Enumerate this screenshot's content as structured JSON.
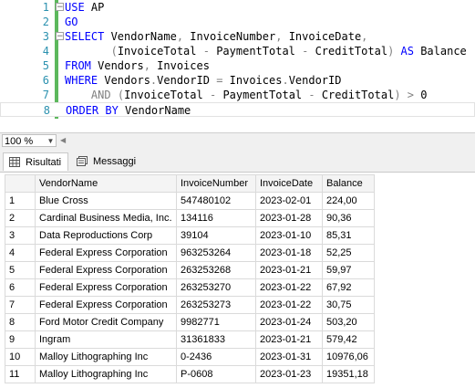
{
  "editor": {
    "lines": [
      {
        "n": "1",
        "tokens": [
          [
            "kw",
            "USE"
          ],
          [
            "tx",
            " AP"
          ]
        ]
      },
      {
        "n": "2",
        "tokens": [
          [
            "kw",
            "GO"
          ]
        ]
      },
      {
        "n": "3",
        "tokens": [
          [
            "kw",
            "SELECT"
          ],
          [
            "tx",
            " VendorName"
          ],
          [
            "op",
            ","
          ],
          [
            "tx",
            " InvoiceNumber"
          ],
          [
            "op",
            ","
          ],
          [
            "tx",
            " InvoiceDate"
          ],
          [
            "op",
            ","
          ]
        ]
      },
      {
        "n": "4",
        "tokens": [
          [
            "tx",
            "       "
          ],
          [
            "op",
            "("
          ],
          [
            "tx",
            "InvoiceTotal "
          ],
          [
            "op",
            "-"
          ],
          [
            "tx",
            " PaymentTotal "
          ],
          [
            "op",
            "-"
          ],
          [
            "tx",
            " CreditTotal"
          ],
          [
            "op",
            ")"
          ],
          [
            "kw",
            " AS"
          ],
          [
            "tx",
            " Balance"
          ]
        ]
      },
      {
        "n": "5",
        "tokens": [
          [
            "kw",
            "FROM"
          ],
          [
            "tx",
            " Vendors"
          ],
          [
            "op",
            ","
          ],
          [
            "tx",
            " Invoices"
          ]
        ]
      },
      {
        "n": "6",
        "tokens": [
          [
            "kw",
            "WHERE"
          ],
          [
            "tx",
            " Vendors"
          ],
          [
            "op",
            "."
          ],
          [
            "tx",
            "VendorID "
          ],
          [
            "op",
            "="
          ],
          [
            "tx",
            " Invoices"
          ],
          [
            "op",
            "."
          ],
          [
            "tx",
            "VendorID"
          ]
        ]
      },
      {
        "n": "7",
        "tokens": [
          [
            "tx",
            "    "
          ],
          [
            "op",
            "AND"
          ],
          [
            "tx",
            " "
          ],
          [
            "op",
            "("
          ],
          [
            "tx",
            "InvoiceTotal "
          ],
          [
            "op",
            "-"
          ],
          [
            "tx",
            " PaymentTotal "
          ],
          [
            "op",
            "-"
          ],
          [
            "tx",
            " CreditTotal"
          ],
          [
            "op",
            ")"
          ],
          [
            "tx",
            " "
          ],
          [
            "op",
            ">"
          ],
          [
            "tx",
            " 0"
          ]
        ]
      },
      {
        "n": "8",
        "tokens": [
          [
            "kw",
            "ORDER BY"
          ],
          [
            "tx",
            " VendorName"
          ]
        ]
      }
    ]
  },
  "zoom": {
    "value": "100 %"
  },
  "tabs": {
    "results": "Risultati",
    "messages": "Messaggi"
  },
  "grid": {
    "columns": [
      "VendorName",
      "InvoiceNumber",
      "InvoiceDate",
      "Balance"
    ],
    "rows": [
      [
        "1",
        "Blue Cross",
        "547480102",
        "2023-02-01",
        "224,00"
      ],
      [
        "2",
        "Cardinal Business Media, Inc.",
        "134116",
        "2023-01-28",
        "90,36"
      ],
      [
        "3",
        "Data Reproductions Corp",
        "39104",
        "2023-01-10",
        "85,31"
      ],
      [
        "4",
        "Federal Express Corporation",
        "963253264",
        "2023-01-18",
        "52,25"
      ],
      [
        "5",
        "Federal Express Corporation",
        "263253268",
        "2023-01-21",
        "59,97"
      ],
      [
        "6",
        "Federal Express Corporation",
        "263253270",
        "2023-01-22",
        "67,92"
      ],
      [
        "7",
        "Federal Express Corporation",
        "263253273",
        "2023-01-22",
        "30,75"
      ],
      [
        "8",
        "Ford Motor Credit Company",
        "9982771",
        "2023-01-24",
        "503,20"
      ],
      [
        "9",
        "Ingram",
        "31361833",
        "2023-01-21",
        "579,42"
      ],
      [
        "10",
        "Malloy Lithographing Inc",
        "0-2436",
        "2023-01-31",
        "10976,06"
      ],
      [
        "11",
        "Malloy Lithographing Inc",
        "P-0608",
        "2023-01-23",
        "19351,18"
      ]
    ]
  }
}
